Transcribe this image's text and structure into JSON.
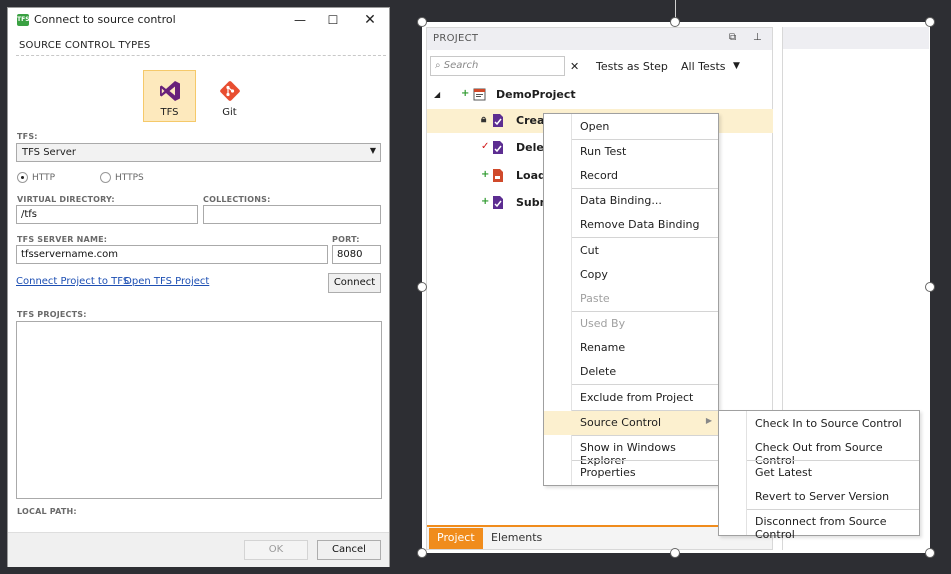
{
  "dialog": {
    "title": "Connect to source control",
    "app_badge": "TFS",
    "section_title": "SOURCE CONTROL TYPES",
    "types": [
      {
        "label": "TFS",
        "icon": "visual-studio-icon",
        "selected": true,
        "color": "#68217a"
      },
      {
        "label": "Git",
        "icon": "git-icon",
        "selected": false,
        "color": "#e84e31"
      }
    ],
    "tfs_label": "TFS:",
    "tfs_value": "TFS Server",
    "protocols": [
      {
        "label": "HTTP",
        "checked": true
      },
      {
        "label": "HTTPS",
        "checked": false
      }
    ],
    "virtual_directory_label": "VIRTUAL DIRECTORY:",
    "virtual_directory_value": "/tfs",
    "collections_label": "COLLECTIONS:",
    "collections_value": "",
    "server_name_label": "TFS SERVER NAME:",
    "server_name_value": "tfsservername.com",
    "port_label": "PORT:",
    "port_value": "8080",
    "link_connect": "Connect Project to TFS",
    "link_open": "Open TFS Project",
    "connect_button": "Connect",
    "projects_label": "TFS PROJECTS:",
    "local_path_label": "LOCAL PATH:",
    "ok_button": "OK",
    "cancel_button": "Cancel"
  },
  "panel": {
    "title": "PROJECT",
    "search_placeholder": "Search",
    "clear": "✕",
    "tests_as_step": "Tests as Step",
    "all_tests": "All Tests",
    "tree": [
      {
        "mark": "+",
        "label": "DemoProject",
        "icon": "project-icon"
      },
      {
        "mark": "a",
        "label": "Creat",
        "icon": "test-icon"
      },
      {
        "mark": "✓",
        "label": "Delet",
        "icon": "test-icon"
      },
      {
        "mark": "+",
        "label": "LoadT",
        "icon": "load-test-icon"
      },
      {
        "mark": "+",
        "label": "Subm",
        "icon": "test-icon"
      }
    ],
    "tabs": [
      "Project",
      "Elements"
    ]
  },
  "context_menu": {
    "items": [
      "Open",
      "Run Test",
      "Record",
      "Data Binding...",
      "Remove Data Binding",
      "Cut",
      "Copy",
      "Paste",
      "Used By",
      "Rename",
      "Delete",
      "Exclude from Project",
      "Source Control",
      "Show in Windows Explorer",
      "Properties"
    ]
  },
  "submenu": {
    "items": [
      "Check In to Source Control",
      "Check Out from Source Control",
      "Get Latest",
      "Revert to Server Version",
      "Disconnect from Source Control"
    ]
  }
}
